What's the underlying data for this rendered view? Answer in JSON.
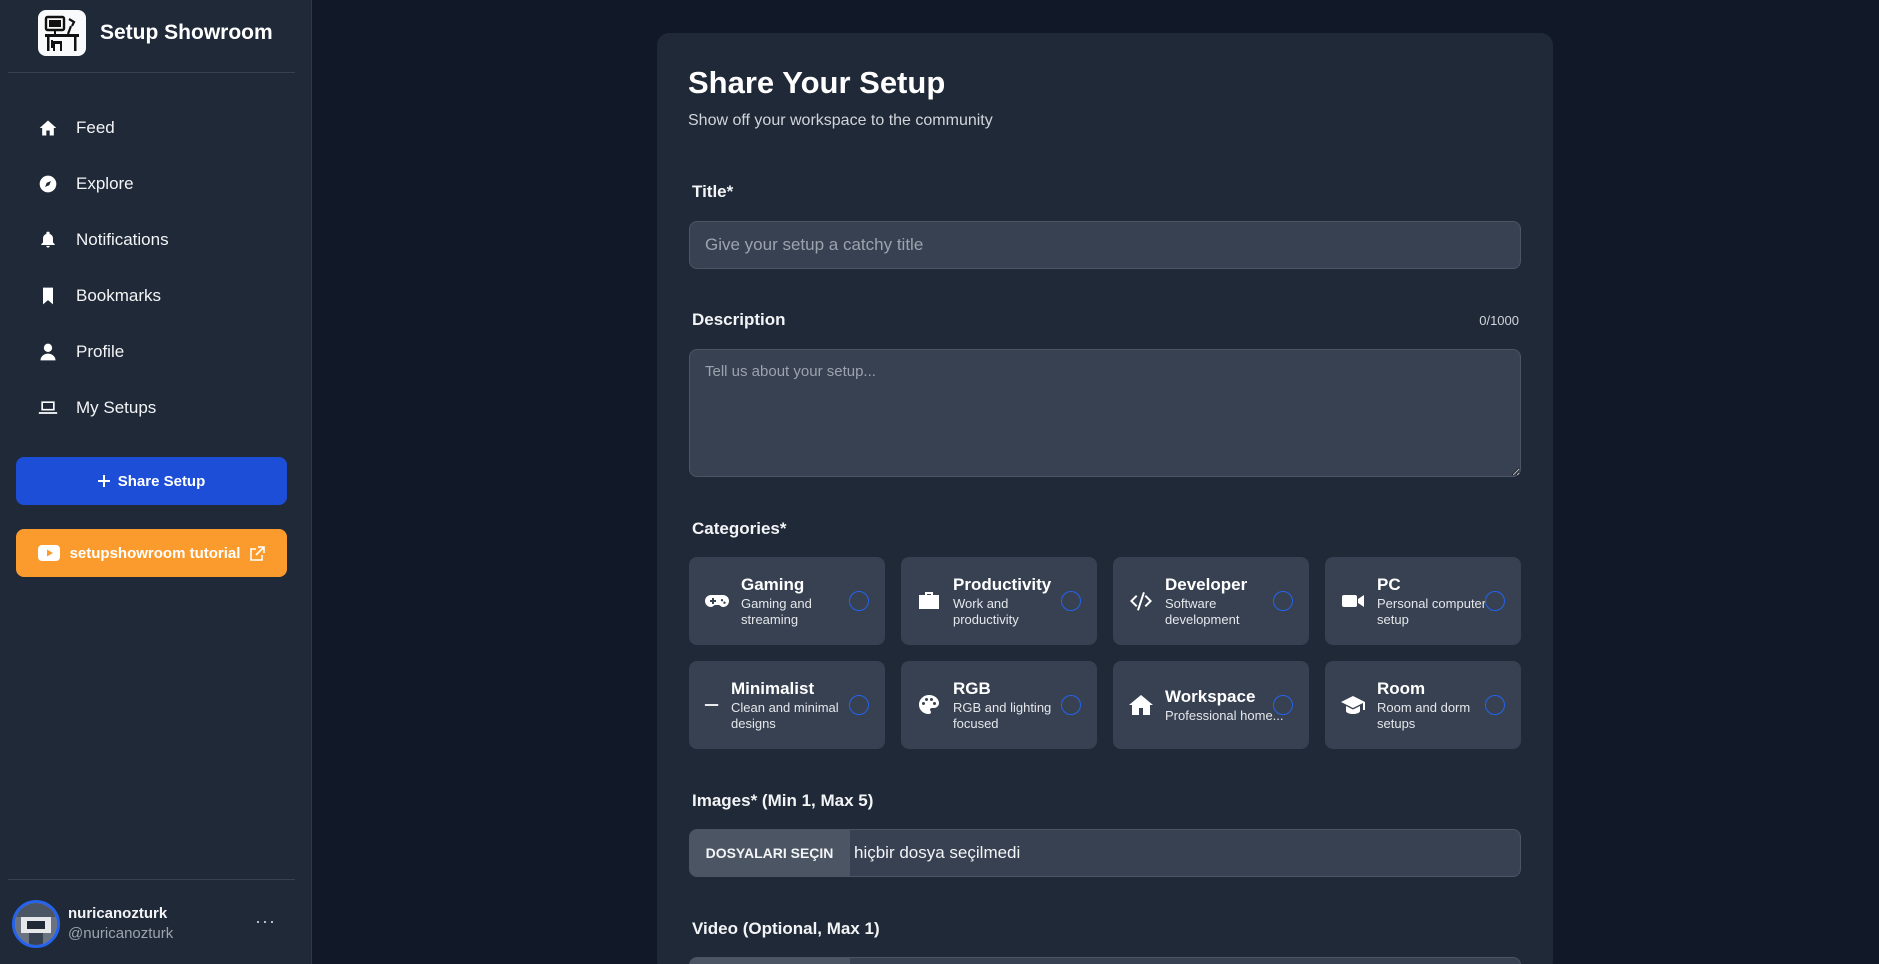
{
  "app": {
    "title": "Setup Showroom"
  },
  "sidebar": {
    "nav": [
      {
        "label": "Feed",
        "icon": "home-icon"
      },
      {
        "label": "Explore",
        "icon": "compass-icon"
      },
      {
        "label": "Notifications",
        "icon": "bell-icon"
      },
      {
        "label": "Bookmarks",
        "icon": "bookmark-icon"
      },
      {
        "label": "Profile",
        "icon": "user-icon"
      },
      {
        "label": "My Setups",
        "icon": "laptop-icon"
      }
    ],
    "share_button": "Share Setup",
    "tutorial_button": "setupshowroom tutorial",
    "user": {
      "name": "nuricanozturk",
      "handle": "@nuricanozturk"
    }
  },
  "form": {
    "title": "Share Your Setup",
    "subtitle": "Show off your workspace to the community",
    "title_label": "Title*",
    "title_placeholder": "Give your setup a catchy title",
    "description_label": "Description",
    "description_counter": "0/1000",
    "description_placeholder": "Tell us about your setup...",
    "categories_label": "Categories*",
    "categories": [
      {
        "name": "Gaming",
        "desc": "Gaming and streaming",
        "icon": "gamepad-icon"
      },
      {
        "name": "Productivity",
        "desc": "Work and productivity",
        "icon": "briefcase-icon"
      },
      {
        "name": "Developer",
        "desc": "Software development",
        "icon": "code-icon"
      },
      {
        "name": "PC",
        "desc": "Personal computer setup",
        "icon": "video-camera-icon"
      },
      {
        "name": "Minimalist",
        "desc": "Clean and minimal designs",
        "icon": "minus-icon"
      },
      {
        "name": "RGB",
        "desc": "RGB and lighting focused",
        "icon": "palette-icon"
      },
      {
        "name": "Workspace",
        "desc": "Professional home...",
        "icon": "house-icon"
      },
      {
        "name": "Room",
        "desc": "Room and dorm setups",
        "icon": "graduation-cap-icon"
      }
    ],
    "images_label": "Images* (Min 1, Max 5)",
    "images_button": "DOSYALARI SEÇIN",
    "images_status": "hiçbir dosya seçilmedi",
    "video_label": "Video (Optional, Max 1)"
  },
  "colors": {
    "accent_blue": "#1d4ed8",
    "accent_orange": "#fb9b2e",
    "background": "#111827",
    "card": "#1f2937",
    "field": "#374151"
  }
}
